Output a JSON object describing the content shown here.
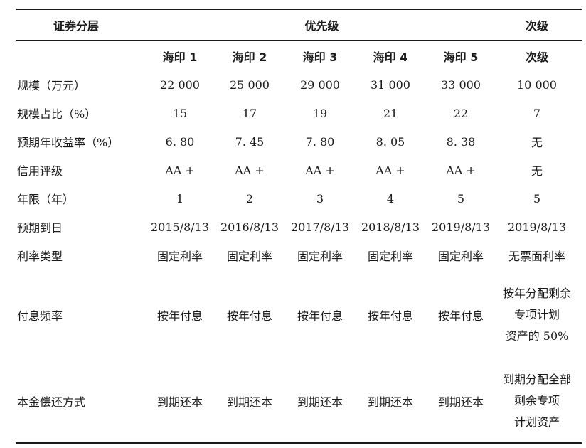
{
  "header": {
    "col0": "证券分层",
    "priority_group": "优先级",
    "sub_group": "次级",
    "columns": [
      "海印 1",
      "海印 2",
      "海印 3",
      "海印 4",
      "海印 5",
      "次级"
    ]
  },
  "rows": [
    {
      "label": "规模（万元）",
      "values": [
        "22 000",
        "25 000",
        "29 000",
        "31 000",
        "33 000",
        "10 000"
      ]
    },
    {
      "label": "规模占比（%）",
      "values": [
        "15",
        "17",
        "19",
        "21",
        "22",
        "7"
      ]
    },
    {
      "label": "预期年收益率（%）",
      "values": [
        "6. 80",
        "7. 45",
        "7. 80",
        "8. 05",
        "8. 38",
        "无"
      ]
    },
    {
      "label": "信用评级",
      "values": [
        "AA +",
        "AA +",
        "AA +",
        "AA +",
        "AA +",
        "无"
      ]
    },
    {
      "label": "年限（年）",
      "values": [
        "1",
        "2",
        "3",
        "4",
        "5",
        "5"
      ]
    },
    {
      "label": "预期到日",
      "values": [
        "2015/8/13",
        "2016/8/13",
        "2017/8/13",
        "2018/8/13",
        "2019/8/13",
        "2019/8/13"
      ]
    },
    {
      "label": "利率类型",
      "values": [
        "固定利率",
        "固定利率",
        "固定利率",
        "固定利率",
        "固定利率",
        "无票面利率"
      ]
    }
  ],
  "payment_frequency": {
    "label": "付息频率",
    "values": [
      "按年付息",
      "按年付息",
      "按年付息",
      "按年付息",
      "按年付息"
    ],
    "sub_lines": [
      "按年分配剩余",
      "专项计划",
      "资产的 50%"
    ]
  },
  "principal_repayment": {
    "label": "本金偿还方式",
    "values": [
      "到期还本",
      "到期还本",
      "到期还本",
      "到期还本",
      "到期还本"
    ],
    "sub_lines": [
      "到期分配全部",
      "剩余专项",
      "计划资产"
    ]
  }
}
